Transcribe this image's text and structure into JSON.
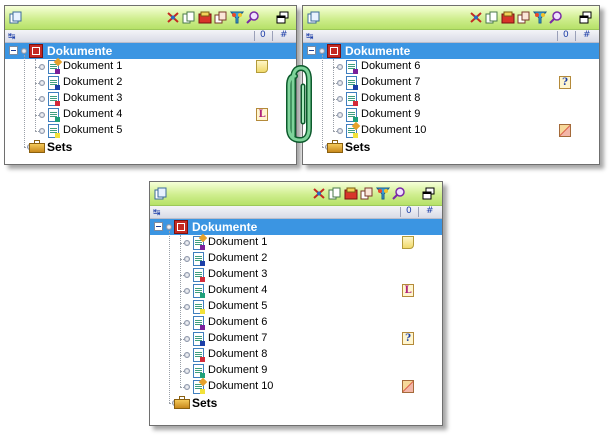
{
  "colors": {
    "toolbar_top": "#f6ffd8",
    "toolbar_bottom": "#b6e168",
    "selected_row": "#3b95e2",
    "root_folder": "#c42a22",
    "paperclip": "#1f8a4a"
  },
  "toolbar_icons": [
    "copy-pages-icon",
    "tools-cross-icon",
    "copy-icon",
    "box-icon",
    "duplicate-icon",
    "color-filter-icon",
    "magnifier-icon",
    "restore-window-icon"
  ],
  "subbar": {
    "left_icon": "↹",
    "right_a": "0",
    "right_b": "#"
  },
  "panels": [
    {
      "root_label": "Dokumente",
      "documents": [
        {
          "label": "Dokument 1",
          "marker": "#7a1f9a",
          "tag": "note",
          "tag_text": ""
        },
        {
          "label": "Dokument 2",
          "marker": "#1b3fa8",
          "tag": "",
          "tag_text": ""
        },
        {
          "label": "Dokument 3",
          "marker": "#d42a3a",
          "tag": "",
          "tag_text": ""
        },
        {
          "label": "Dokument 4",
          "marker": "#1fa17a",
          "tag": "L",
          "tag_text": "L"
        },
        {
          "label": "Dokument 5",
          "marker": "#f2e23a",
          "tag": "",
          "tag_text": ""
        }
      ],
      "sets_label": "Sets"
    },
    {
      "root_label": "Dokumente",
      "documents": [
        {
          "label": "Dokument 6",
          "marker": "#7a1f9a",
          "tag": "",
          "tag_text": ""
        },
        {
          "label": "Dokument 7",
          "marker": "#1b3fa8",
          "tag": "q",
          "tag_text": "?"
        },
        {
          "label": "Dokument 8",
          "marker": "#d42a3a",
          "tag": "",
          "tag_text": ""
        },
        {
          "label": "Dokument 9",
          "marker": "#1fa17a",
          "tag": "",
          "tag_text": ""
        },
        {
          "label": "Dokument 10",
          "marker": "#f2e23a",
          "tag": "slash",
          "tag_text": ""
        }
      ],
      "sets_label": "Sets"
    },
    {
      "root_label": "Dokumente",
      "documents": [
        {
          "label": "Dokument 1",
          "marker": "#7a1f9a",
          "tag": "note",
          "tag_text": ""
        },
        {
          "label": "Dokument 2",
          "marker": "#1b3fa8",
          "tag": "",
          "tag_text": ""
        },
        {
          "label": "Dokument 3",
          "marker": "#d42a3a",
          "tag": "",
          "tag_text": ""
        },
        {
          "label": "Dokument 4",
          "marker": "#1fa17a",
          "tag": "L",
          "tag_text": "L"
        },
        {
          "label": "Dokument 5",
          "marker": "#f2e23a",
          "tag": "",
          "tag_text": ""
        },
        {
          "label": "Dokument 6",
          "marker": "#7a1f9a",
          "tag": "",
          "tag_text": ""
        },
        {
          "label": "Dokument 7",
          "marker": "#1b3fa8",
          "tag": "q",
          "tag_text": "?"
        },
        {
          "label": "Dokument 8",
          "marker": "#d42a3a",
          "tag": "",
          "tag_text": ""
        },
        {
          "label": "Dokument 9",
          "marker": "#1fa17a",
          "tag": "",
          "tag_text": ""
        },
        {
          "label": "Dokument 10",
          "marker": "#f2e23a",
          "tag": "slash",
          "tag_text": ""
        }
      ],
      "sets_label": "Sets"
    }
  ]
}
